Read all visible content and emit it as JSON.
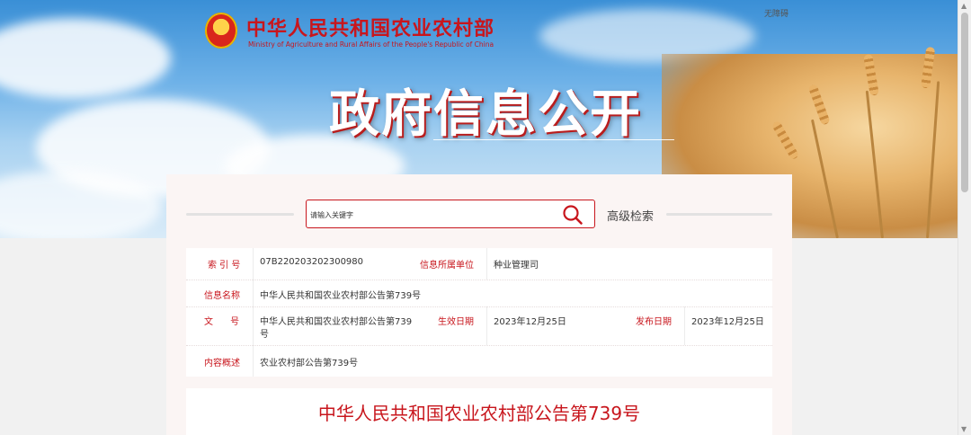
{
  "header": {
    "ministry_cn": "中华人民共和国农业农村部",
    "ministry_en": "Ministry of Agriculture and Rural Affairs of the People's Republic of China",
    "accessibility": "无障碍",
    "title": "政府信息公开"
  },
  "search": {
    "placeholder": "请输入关键字",
    "advanced_label": "高级检索"
  },
  "info": {
    "index_label": "索 引 号",
    "index_value": "07B220203202300980",
    "dept_label": "信息所属单位",
    "dept_value": "种业管理司",
    "name_label": "信息名称",
    "name_value": "中华人民共和国农业农村部公告第739号",
    "doc_label": "文 号",
    "doc_value_line1": "中华人民共和国农业农村部公告第739",
    "doc_value_line2": "号",
    "effective_label": "生效日期",
    "effective_value": "2023年12月25日",
    "publish_label": "发布日期",
    "publish_value": "2023年12月25日",
    "summary_label": "内容概述",
    "summary_value": "农业农村部公告第739号"
  },
  "document": {
    "title": "中华人民共和国农业农村部公告第739号"
  },
  "colors": {
    "accent_red": "#c8161d",
    "panel_bg": "#fbf5f4"
  }
}
